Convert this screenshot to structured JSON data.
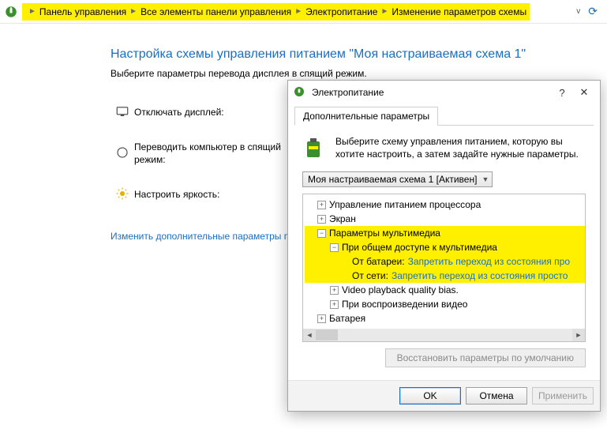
{
  "breadcrumb": {
    "items": [
      "Панель управления",
      "Все элементы панели управления",
      "Электропитание",
      "Изменение параметров схемы"
    ]
  },
  "page": {
    "title": "Настройка схемы управления питанием \"Моя настраиваемая схема 1\"",
    "subtitle": "Выберите параметры перевода дисплея в спящий режим.",
    "row_display": "Отключать дисплей:",
    "row_sleep": "Переводить компьютер в спящий режим:",
    "row_brightness": "Настроить яркость:",
    "advanced_link": "Изменить дополнительные параметры п"
  },
  "dialog": {
    "title": "Электропитание",
    "tab": "Дополнительные параметры",
    "intro": "Выберите схему управления питанием, которую вы хотите настроить, а затем задайте нужные параметры.",
    "scheme": "Моя настраиваемая схема 1 [Активен]",
    "tree": {
      "cpu": "Управление питанием процессора",
      "screen": "Экран",
      "mm": "Параметры мультимедиа",
      "mm_share": "При общем доступе к мультимедиа",
      "on_battery_k": "От батареи:",
      "on_battery_v": "Запретить переход из состояния про",
      "on_ac_k": "От сети:",
      "on_ac_v": "Запретить переход из состояния просто",
      "video_bias": "Video playback quality bias.",
      "video_play": "При воспроизведении видео",
      "battery": "Батарея"
    },
    "restore": "Восстановить параметры по умолчанию",
    "buttons": {
      "ok": "OK",
      "cancel": "Отмена",
      "apply": "Применить"
    }
  }
}
